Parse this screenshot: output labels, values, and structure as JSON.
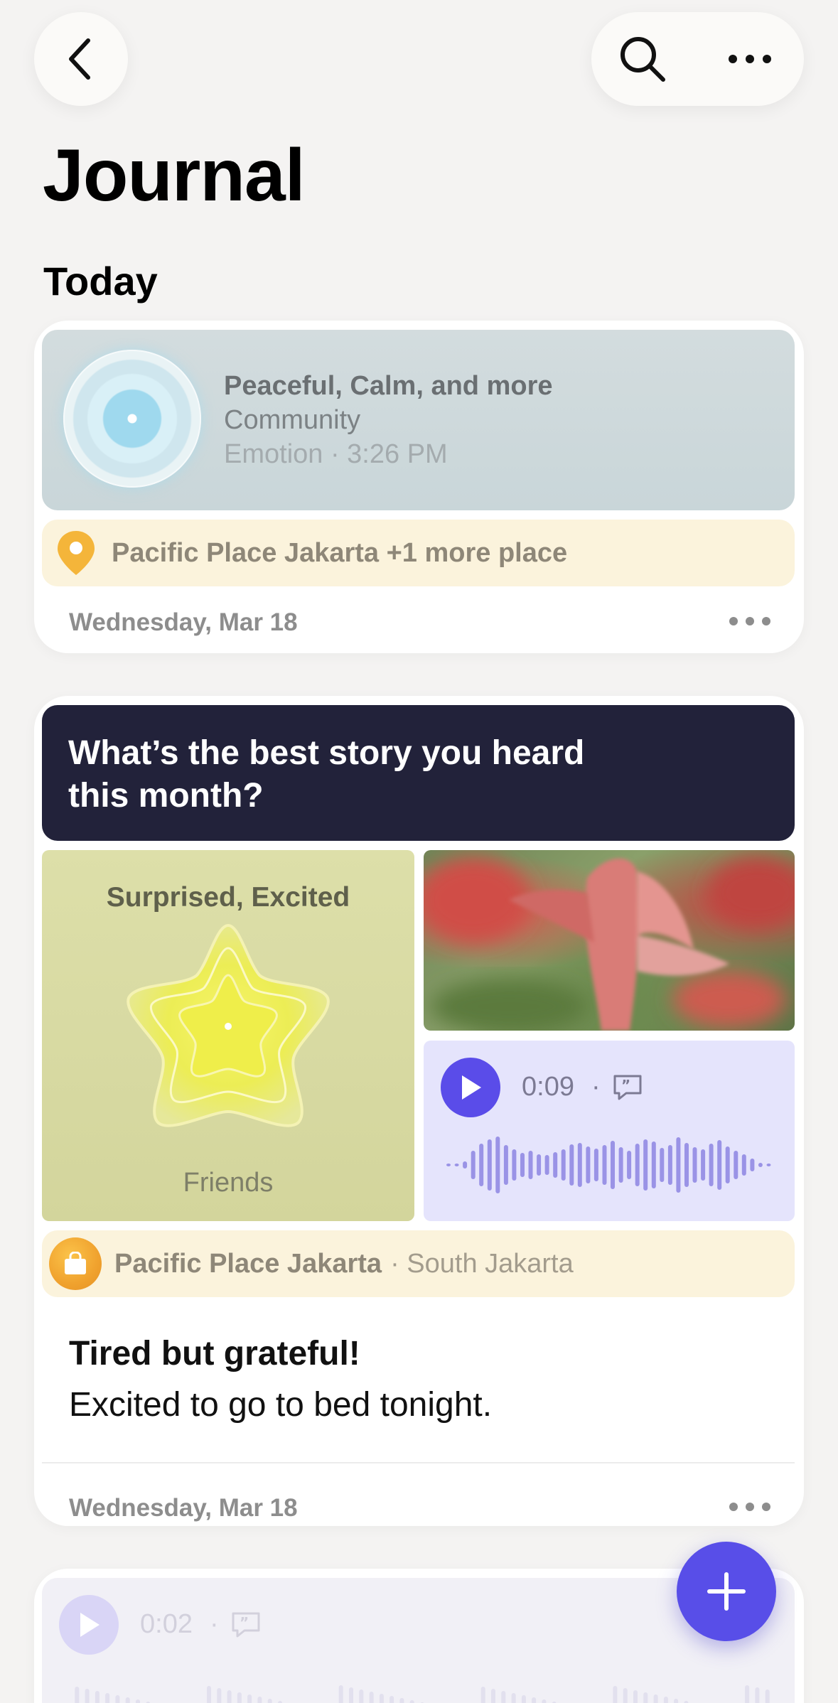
{
  "header": {
    "back_icon": "chevron-left-icon",
    "search_icon": "search-icon",
    "more_icon": "ellipsis-icon",
    "title": "Journal"
  },
  "section": {
    "today_label": "Today"
  },
  "entries": [
    {
      "emotion_title": "Peaceful, Calm, and more",
      "emotion_context": "Community",
      "emotion_meta": "Emotion · 3:26 PM",
      "place": "Pacific Place Jakarta +1 more place",
      "date": "Wednesday, Mar 18"
    },
    {
      "prompt": "What’s the best story you heard this month?",
      "mood_label": "Surprised, Excited",
      "mood_context": "Friends",
      "audio_time": "0:09",
      "audio_separator": "·",
      "place_name": "Pacific Place Jakarta",
      "place_area": "· South Jakarta",
      "title": "Tired but grateful!",
      "body": "Excited to go to bed tonight.",
      "date": "Wednesday, Mar 18"
    },
    {
      "audio_time": "0:02",
      "audio_separator": "·"
    }
  ],
  "fab": {
    "icon": "plus-icon"
  },
  "colors": {
    "accent": "#584ee8",
    "prompt_bg": "#22223a",
    "place_bg": "#fbf3dc",
    "audio_bg": "#e5e4fc"
  }
}
